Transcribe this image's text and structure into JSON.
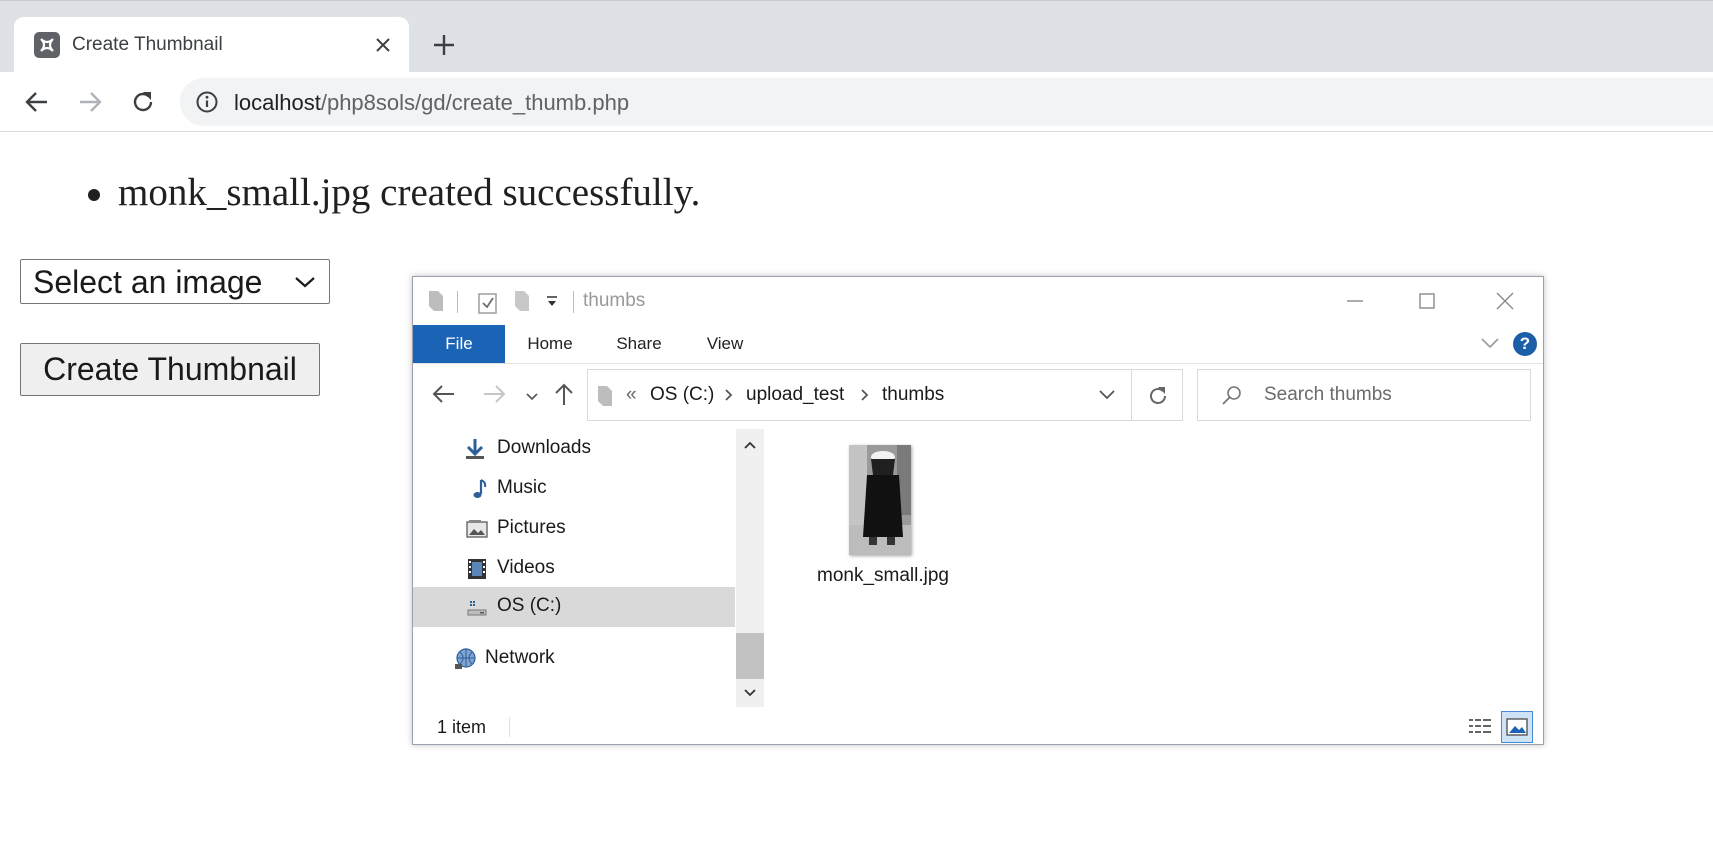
{
  "browser": {
    "tab_title": "Create Thumbnail",
    "url_host": "localhost",
    "url_path": "/php8sols/gd/create_thumb.php"
  },
  "page": {
    "messages": [
      "monk_small.jpg created successfully."
    ],
    "select": {
      "selected": "Select an image"
    },
    "create_button": "Create Thumbnail"
  },
  "explorer": {
    "title": "thumbs",
    "ribbon_tabs": [
      "File",
      "Home",
      "Share",
      "View"
    ],
    "help": "?",
    "breadcrumb": {
      "overflow": "«",
      "parts": [
        "OS (C:)",
        "upload_test",
        "thumbs"
      ]
    },
    "search_placeholder": "Search thumbs",
    "nav_items": [
      {
        "label": "Downloads",
        "icon": "downloads-icon"
      },
      {
        "label": "Music",
        "icon": "music-icon"
      },
      {
        "label": "Pictures",
        "icon": "pictures-icon"
      },
      {
        "label": "Videos",
        "icon": "videos-icon"
      },
      {
        "label": "OS (C:)",
        "icon": "drive-icon",
        "selected": true
      },
      {
        "label": "Network",
        "icon": "network-icon"
      }
    ],
    "files": [
      {
        "name": "monk_small.jpg"
      }
    ],
    "status": {
      "item_count": "1 item"
    },
    "accent": "#1a63b5"
  }
}
